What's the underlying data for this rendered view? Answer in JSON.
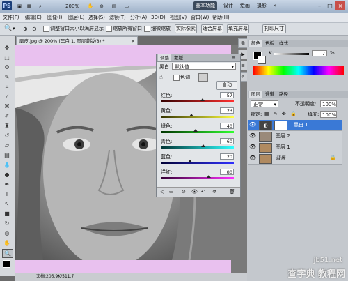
{
  "titlebar": {
    "logo": "PS",
    "zoom": "200%",
    "workspaces": [
      "基本功能",
      "设计",
      "绘画",
      "摄影"
    ],
    "controls": [
      "–",
      "□",
      "×"
    ]
  },
  "menubar": {
    "items": [
      "文件(F)",
      "编辑(E)",
      "图像(I)",
      "图层(L)",
      "选择(S)",
      "滤镜(T)",
      "分析(A)",
      "3D(D)",
      "视图(V)",
      "窗口(W)",
      "帮助(H)"
    ]
  },
  "options": {
    "check1": "调整窗口大小以满屏显示",
    "check2": "缩放所有窗口",
    "check3": "细微缩放",
    "buttons": [
      "实际像素",
      "适合屏幕",
      "填充屏幕",
      "打印尺寸"
    ]
  },
  "document": {
    "tab": "磨皮.jpg @ 200% (黑白 1, 图层蒙版/8) *",
    "status": "文档:205.9K/511.7"
  },
  "adjust_panel": {
    "tabs": [
      "调整",
      "蒙版"
    ],
    "preset_name": "黑白",
    "preset_value": "默认值",
    "tint_label": "色调",
    "auto_label": "自动",
    "sliders": [
      {
        "label": "红色:",
        "value": "57",
        "pct": 0.57,
        "grad": "#330000,#ff3030"
      },
      {
        "label": "黄色:",
        "value": "23",
        "pct": 0.42,
        "grad": "#333300,#ffff40"
      },
      {
        "label": "绿色:",
        "value": "40",
        "pct": 0.48,
        "grad": "#003300,#30ff30"
      },
      {
        "label": "青色:",
        "value": "60",
        "pct": 0.58,
        "grad": "#003333,#30ffff"
      },
      {
        "label": "蓝色:",
        "value": "20",
        "pct": 0.4,
        "grad": "#000033,#3030ff"
      },
      {
        "label": "洋红:",
        "value": "80",
        "pct": 0.66,
        "grad": "#330033,#ff30ff"
      }
    ]
  },
  "color_panel": {
    "tabs": [
      "颜色",
      "色板",
      "样式"
    ],
    "k_label": "K",
    "k_value": "7",
    "k_unit": "%"
  },
  "layers_panel": {
    "tabs": [
      "图层",
      "通道",
      "路径"
    ],
    "blend_mode": "正常",
    "opacity_label": "不透明度:",
    "opacity": "100%",
    "lock_label": "锁定:",
    "fill_label": "填充:",
    "fill": "100%",
    "layers": [
      {
        "name": "黑白 1",
        "selected": true
      },
      {
        "name": "图层 2",
        "selected": false
      },
      {
        "name": "图层 1",
        "selected": false
      },
      {
        "name": "背景",
        "selected": false
      }
    ]
  },
  "watermark": {
    "line1": "jb51.net",
    "line2": "查字典 教程网"
  }
}
